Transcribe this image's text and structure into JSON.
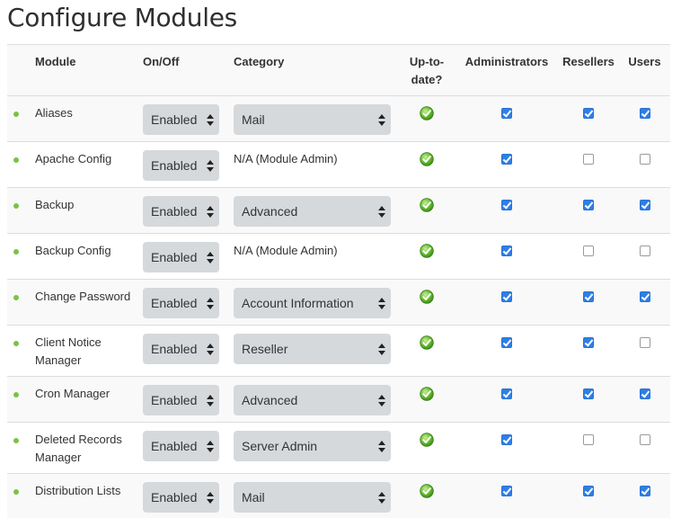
{
  "page": {
    "title": "Configure Modules"
  },
  "columns": {
    "module": "Module",
    "onoff": "On/Off",
    "category": "Category",
    "uptodate": "Up-to-date?",
    "administrators": "Administrators",
    "resellers": "Resellers",
    "users": "Users"
  },
  "colors": {
    "status_dot": "#79c247",
    "checkbox_checked": "#2e7fe6",
    "select_bg": "#d5d9dc"
  },
  "rows": [
    {
      "module": "Aliases",
      "onoff": "Enabled",
      "category": "Mail",
      "category_editable": true,
      "uptodate": "check-circle-icon",
      "administrators": true,
      "resellers": true,
      "users": true
    },
    {
      "module": "Apache Config",
      "onoff": "Enabled",
      "category": "N/A (Module Admin)",
      "category_editable": false,
      "uptodate": "check-circle-icon",
      "administrators": true,
      "resellers": false,
      "users": false
    },
    {
      "module": "Backup",
      "onoff": "Enabled",
      "category": "Advanced",
      "category_editable": true,
      "uptodate": "check-circle-icon",
      "administrators": true,
      "resellers": true,
      "users": true
    },
    {
      "module": "Backup Config",
      "onoff": "Enabled",
      "category": "N/A (Module Admin)",
      "category_editable": false,
      "uptodate": "check-circle-icon",
      "administrators": true,
      "resellers": false,
      "users": false
    },
    {
      "module": "Change Password",
      "onoff": "Enabled",
      "category": "Account Information",
      "category_editable": true,
      "uptodate": "check-circle-icon",
      "administrators": true,
      "resellers": true,
      "users": true
    },
    {
      "module": "Client Notice Manager",
      "onoff": "Enabled",
      "category": "Reseller",
      "category_editable": true,
      "uptodate": "check-circle-icon",
      "administrators": true,
      "resellers": true,
      "users": false
    },
    {
      "module": "Cron Manager",
      "onoff": "Enabled",
      "category": "Advanced",
      "category_editable": true,
      "uptodate": "check-circle-icon",
      "administrators": true,
      "resellers": true,
      "users": true
    },
    {
      "module": "Deleted Records Manager",
      "onoff": "Enabled",
      "category": "Server Admin",
      "category_editable": true,
      "uptodate": "check-circle-icon",
      "administrators": true,
      "resellers": false,
      "users": false
    },
    {
      "module": "Distribution Lists",
      "onoff": "Enabled",
      "category": "Mail",
      "category_editable": true,
      "uptodate": "check-circle-icon",
      "administrators": true,
      "resellers": true,
      "users": true
    }
  ]
}
